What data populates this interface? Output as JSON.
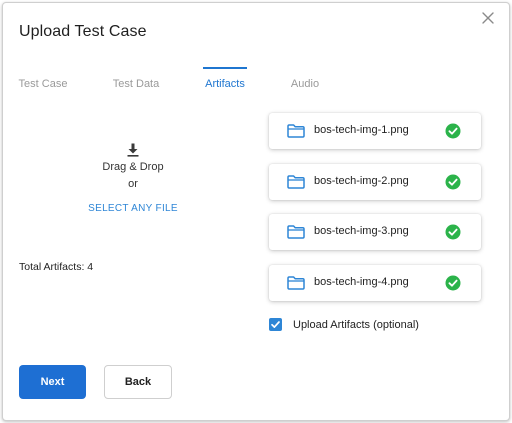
{
  "dialog": {
    "title": "Upload Test Case"
  },
  "tabs": [
    {
      "label": "Test Case"
    },
    {
      "label": "Test Data"
    },
    {
      "label": "Artifacts"
    },
    {
      "label": "Audio"
    }
  ],
  "active_tab": "Artifacts",
  "dropzone": {
    "line1": "Drag & Drop",
    "line2": "or",
    "select_label": "SELECT ANY FILE",
    "icon": "download-icon"
  },
  "total_artifacts_label": "Total Artifacts: 4",
  "artifacts": [
    {
      "name": "bos-tech-img-1.png",
      "icon": "folder-icon",
      "status_icon": "check-circle-icon"
    },
    {
      "name": "bos-tech-img-2.png",
      "icon": "folder-icon",
      "status_icon": "check-circle-icon"
    },
    {
      "name": "bos-tech-img-3.png",
      "icon": "folder-icon",
      "status_icon": "check-circle-icon"
    },
    {
      "name": "bos-tech-img-4.png",
      "icon": "folder-icon",
      "status_icon": "check-circle-icon"
    }
  ],
  "upload_optional": {
    "label": "Upload Artifacts (optional)",
    "checked": true
  },
  "buttons": {
    "next_label": "Next",
    "back_label": "Back"
  },
  "colors": {
    "accent": "#1f76d0",
    "primary_button": "#1e6fd3",
    "success": "#2bb34a",
    "inactive_tab": "#9a9a9a"
  }
}
